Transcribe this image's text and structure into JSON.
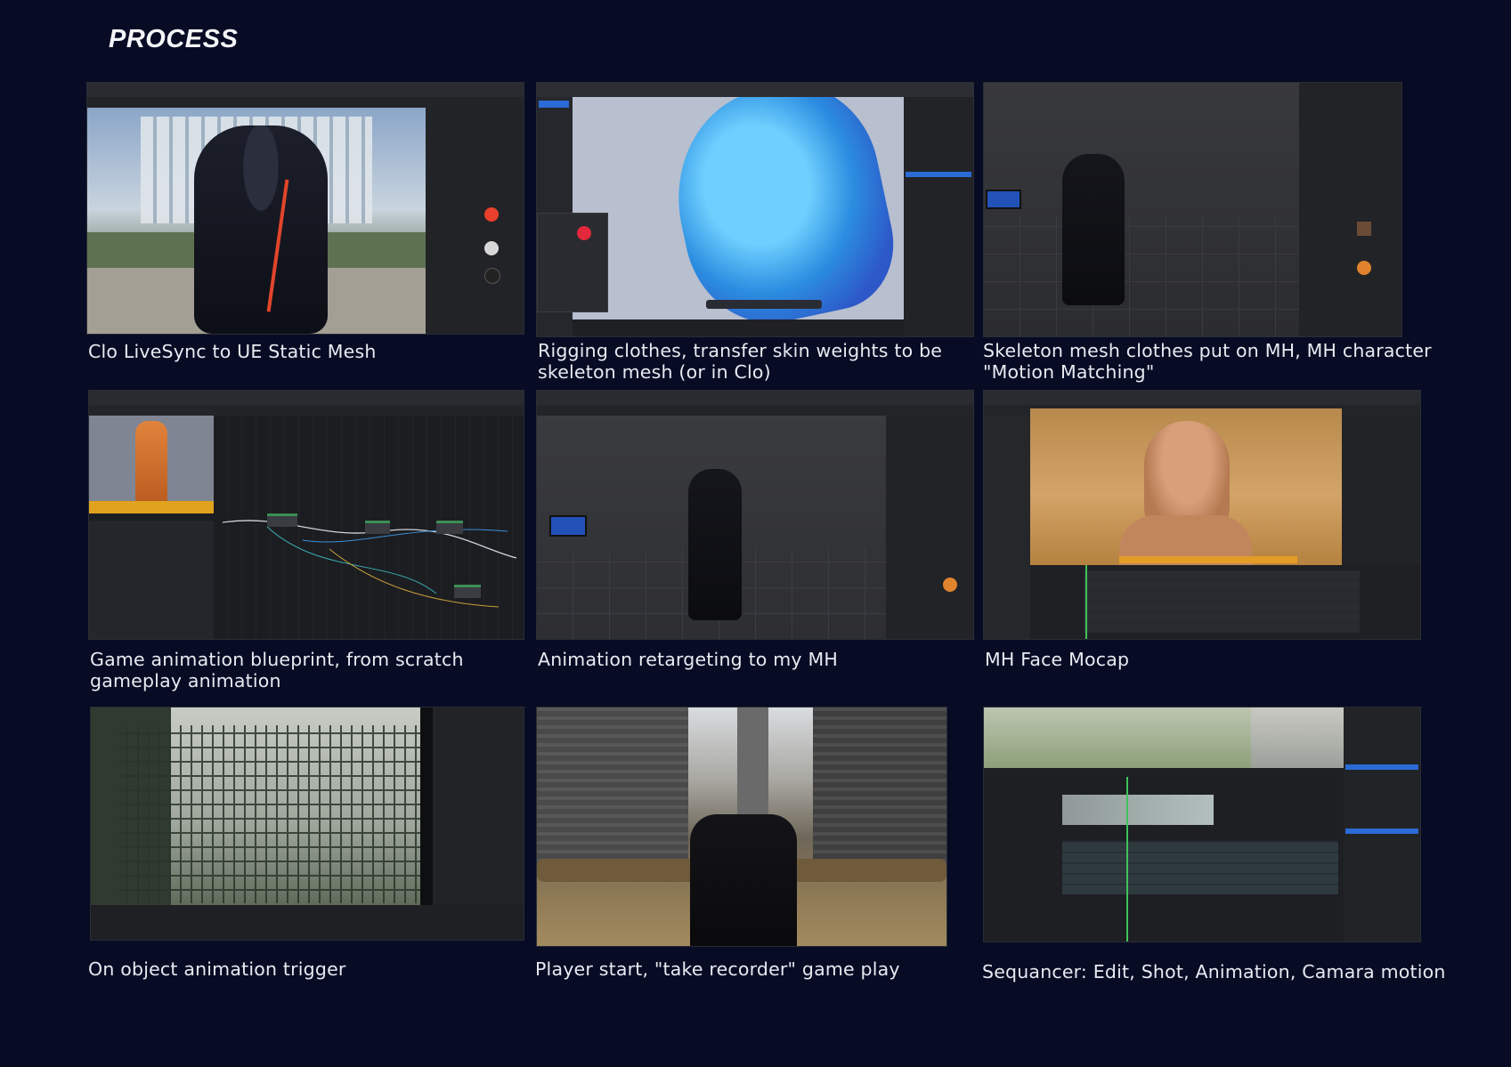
{
  "page": {
    "title": "PROCESS"
  },
  "items": [
    {
      "caption": "Clo LiveSync to UE Static Mesh"
    },
    {
      "caption": "Rigging clothes, transfer skin weights to be skeleton mesh (or in Clo)"
    },
    {
      "caption": "Skeleton mesh clothes put on MH, MH character \"Motion Matching\""
    },
    {
      "caption": "Game animation blueprint, from scratch gameplay animation"
    },
    {
      "caption": "Animation retargeting to my MH"
    },
    {
      "caption": "MH Face Mocap"
    },
    {
      "caption": "On object animation trigger"
    },
    {
      "caption": "Player start, \"take recorder\" game play"
    },
    {
      "caption": "Sequancer: Edit, Shot, Animation, Camara motion"
    }
  ]
}
